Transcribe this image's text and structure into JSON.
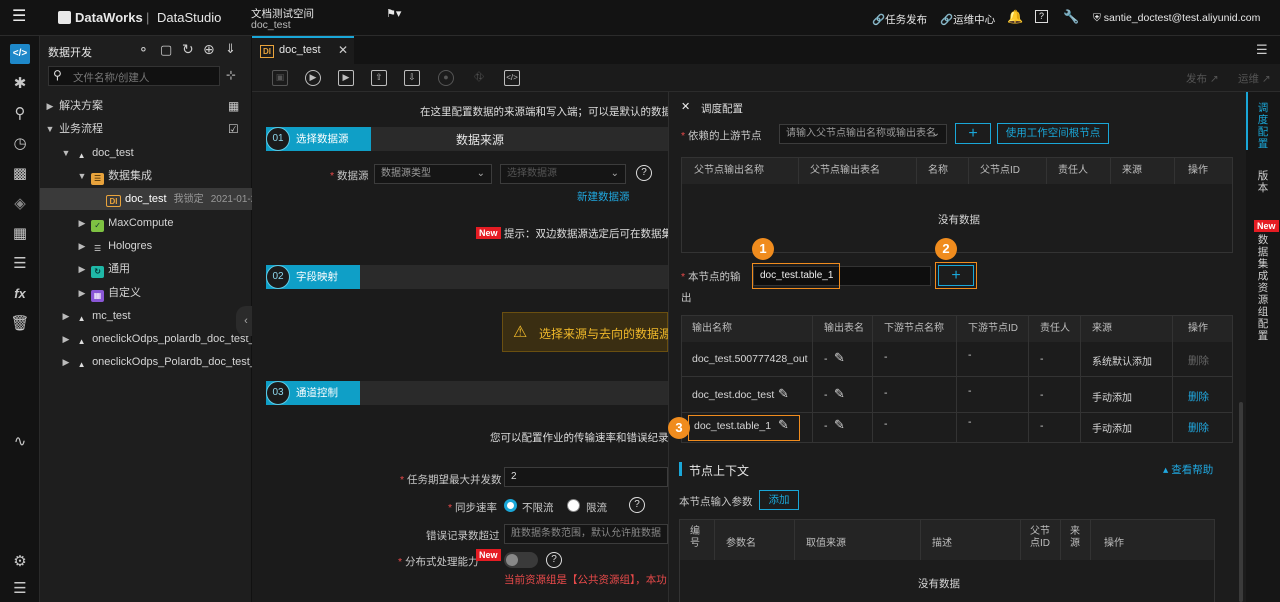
{
  "topbar": {
    "brand": "DataWorks",
    "product": "DataStudio",
    "workspace": "文档测试空间",
    "workspace_sub": "doc_test",
    "publish": "任务发布",
    "ops": "运维中心",
    "user": "santie_doctest@test.aliyunid.com"
  },
  "explorer": {
    "title": "数据开发",
    "search_placeholder": "文件名称/创建人",
    "items": [
      {
        "label": "解决方案"
      },
      {
        "label": "业务流程"
      },
      {
        "label": "doc_test"
      },
      {
        "label": "数据集成"
      },
      {
        "label": "doc_test",
        "lock": "我锁定",
        "date": "2021-01-29"
      },
      {
        "label": "MaxCompute"
      },
      {
        "label": "Hologres"
      },
      {
        "label": "通用"
      },
      {
        "label": "自定义"
      },
      {
        "label": "mc_test"
      },
      {
        "label": "oneclickOdps_polardb_doc_test_02_n"
      },
      {
        "label": "oneclickOdps_Polardb_doc_test_to_M"
      }
    ]
  },
  "editor": {
    "tab": "doc_test",
    "tab_icon": "DI",
    "publish_btn": "发布",
    "ops_btn": "运维",
    "intro": "在这里配置数据的来源端和写入端；可以是默认的数据源",
    "step1": {
      "num": "01",
      "title": "选择数据源",
      "heading": "数据来源"
    },
    "datasource_label": "数据源",
    "ds_type_placeholder": "数据源类型",
    "ds_placeholder": "选择数据源",
    "new_ds": "新建数据源",
    "new_badge": "New",
    "tip": "提示：双边数据源选定后可在数据集",
    "step2": {
      "num": "02",
      "title": "字段映射"
    },
    "warn": "选择来源与去向的数据源",
    "step3": {
      "num": "03",
      "title": "通道控制"
    },
    "channel_intro": "您可以配置作业的传输速率和错误纪录",
    "concurrency_label": "任务期望最大并发数",
    "concurrency_value": "2",
    "speed_label": "同步速率",
    "speed_opt1": "不限流",
    "speed_opt2": "限流",
    "err_label": "错误记录数超过",
    "err_placeholder": "脏数据条数范围，默认允许脏数据",
    "dist_label": "分布式处理能力",
    "res_note": "当前资源组是【公共资源组】，本功"
  },
  "panel": {
    "title": "调度配置",
    "upstream_label": "依赖的上游节点",
    "upstream_placeholder": "请输入父节点输出名称或输出表名",
    "use_root_btn": "使用工作空间根节点",
    "add_symbol": "+",
    "up_headers": [
      "父节点输出名称",
      "父节点输出表名",
      "名称",
      "父节点ID",
      "责任人",
      "来源",
      "操作"
    ],
    "no_data": "没有数据",
    "output_label_1": "本节点的输",
    "output_label_2": "出",
    "output_value": "doc_test.table_1",
    "out_headers": [
      "输出名称",
      "输出表名",
      "下游节点名称",
      "下游节点ID",
      "责任人",
      "来源",
      "操作"
    ],
    "out_rows": [
      {
        "name": "doc_test.500777428_out",
        "table": "-",
        "down": "-",
        "id": "-",
        "owner": "-",
        "source": "系统默认添加",
        "op": "删除"
      },
      {
        "name": "doc_test.doc_test",
        "table": "-",
        "down": "-",
        "id": "-",
        "owner": "-",
        "source": "手动添加",
        "op": "删除"
      },
      {
        "name": "doc_test.table_1",
        "table": "-",
        "down": "-",
        "id": "-",
        "owner": "-",
        "source": "手动添加",
        "op": "删除"
      }
    ],
    "badges": [
      "1",
      "2",
      "3"
    ],
    "ctx_title": "节点上下文",
    "help": "查看帮助",
    "input_params": "本节点输入参数",
    "add_btn": "添加",
    "param_headers": [
      "编号",
      "参数名",
      "取值来源",
      "描述",
      "父节点ID",
      "来源",
      "操作"
    ],
    "param_no_data": "没有数据"
  },
  "right_tabs": {
    "schedule": "调度配置",
    "version": "版本",
    "new": "New",
    "resource": "数据集成资源组配置"
  },
  "colors": {
    "accent": "#1aa7d8",
    "highlight": "#f08c1e",
    "danger": "#e51c23"
  }
}
